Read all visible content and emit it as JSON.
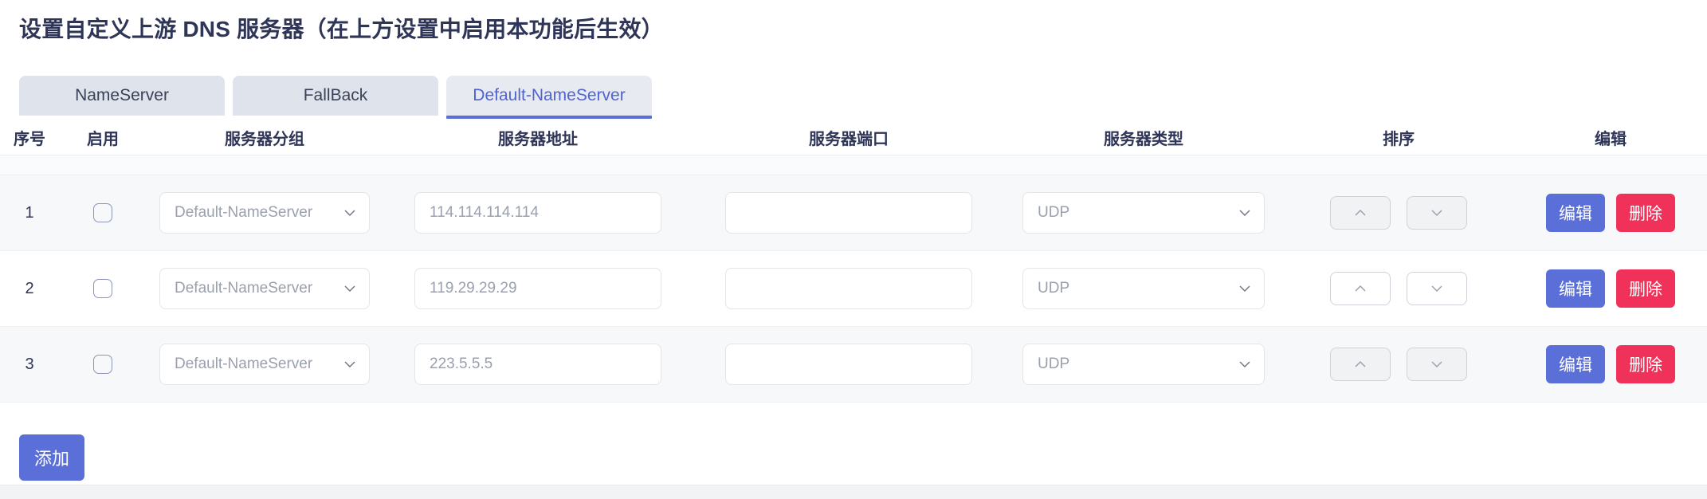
{
  "page": {
    "title": "设置自定义上游 DNS 服务器（在上方设置中启用本功能后生效）"
  },
  "colors": {
    "accent": "#5b6fd8",
    "danger": "#f0325a",
    "tab_active_text": "#4f63d2",
    "tab_inactive_bg": "#dfe3eb",
    "heading": "#2f3557"
  },
  "tabs": [
    {
      "label": "NameServer",
      "active": false
    },
    {
      "label": "FallBack",
      "active": false
    },
    {
      "label": "Default-NameServer",
      "active": true
    }
  ],
  "table": {
    "headers": {
      "index": "序号",
      "enable": "启用",
      "group": "服务器分组",
      "address": "服务器地址",
      "port": "服务器端口",
      "type": "服务器类型",
      "sort": "排序",
      "edit": "编辑"
    },
    "rows": [
      {
        "index": "1",
        "enabled": false,
        "group": "Default-NameServer",
        "address": "114.114.114.114",
        "port": "",
        "type": "UDP",
        "sort_up_icon": "chevron-up-icon",
        "sort_down_icon": "chevron-down-icon",
        "edit_label": "编辑",
        "delete_label": "删除"
      },
      {
        "index": "2",
        "enabled": false,
        "group": "Default-NameServer",
        "address": "119.29.29.29",
        "port": "",
        "type": "UDP",
        "sort_up_icon": "chevron-up-icon",
        "sort_down_icon": "chevron-down-icon",
        "edit_label": "编辑",
        "delete_label": "删除"
      },
      {
        "index": "3",
        "enabled": false,
        "group": "Default-NameServer",
        "address": "223.5.5.5",
        "port": "",
        "type": "UDP",
        "sort_up_icon": "chevron-up-icon",
        "sort_down_icon": "chevron-down-icon",
        "edit_label": "编辑",
        "delete_label": "删除"
      }
    ]
  },
  "footer": {
    "add_label": "添加"
  }
}
